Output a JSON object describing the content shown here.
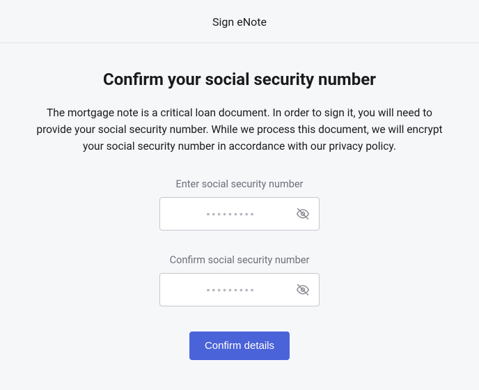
{
  "header": {
    "title": "Sign eNote"
  },
  "main": {
    "heading": "Confirm your social security number",
    "description": "The mortgage note is a critical loan document. In order to sign it, you will need to provide your social security number. While we process this document, we will encrypt your social security number in accordance with our privacy policy."
  },
  "form": {
    "enter": {
      "label": "Enter social security number",
      "value": "",
      "placeholder": "•••••••••"
    },
    "confirm": {
      "label": "Confirm social security number",
      "value": "",
      "placeholder": "•••••••••"
    },
    "submit_label": "Confirm details"
  }
}
